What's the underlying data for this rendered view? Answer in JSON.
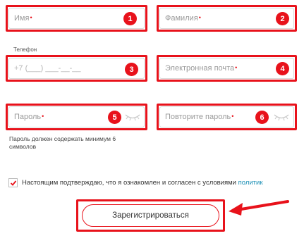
{
  "form": {
    "first_name": {
      "placeholder": "Имя",
      "required_mark": "•",
      "badge": "1"
    },
    "last_name": {
      "placeholder": "Фамилия",
      "required_mark": "•",
      "badge": "2"
    },
    "phone": {
      "label": "Телефон",
      "placeholder": "+7 (___) ___-__-__",
      "badge": "3"
    },
    "email": {
      "placeholder": "Электронная почта",
      "required_mark": "•",
      "badge": "4"
    },
    "password": {
      "placeholder": "Пароль",
      "required_mark": "•",
      "badge": "5",
      "icon": "eye-closed-icon"
    },
    "password_repeat": {
      "placeholder": "Повторите пароль",
      "required_mark": "•",
      "badge": "6",
      "icon": "eye-closed-icon"
    },
    "password_hint": "Пароль должен содержать минимум 6 символов",
    "consent": {
      "checked": true,
      "text": "Настоящим подтверждаю, что я ознакомлен и согласен с условиями",
      "link": "политик"
    },
    "submit_label": "Зарегистрироваться"
  },
  "annotation": {
    "color": "#e8121b",
    "arrow_icon": "red-arrow-icon"
  },
  "accent_color": "#e8121b",
  "link_color": "#1a8fb5"
}
